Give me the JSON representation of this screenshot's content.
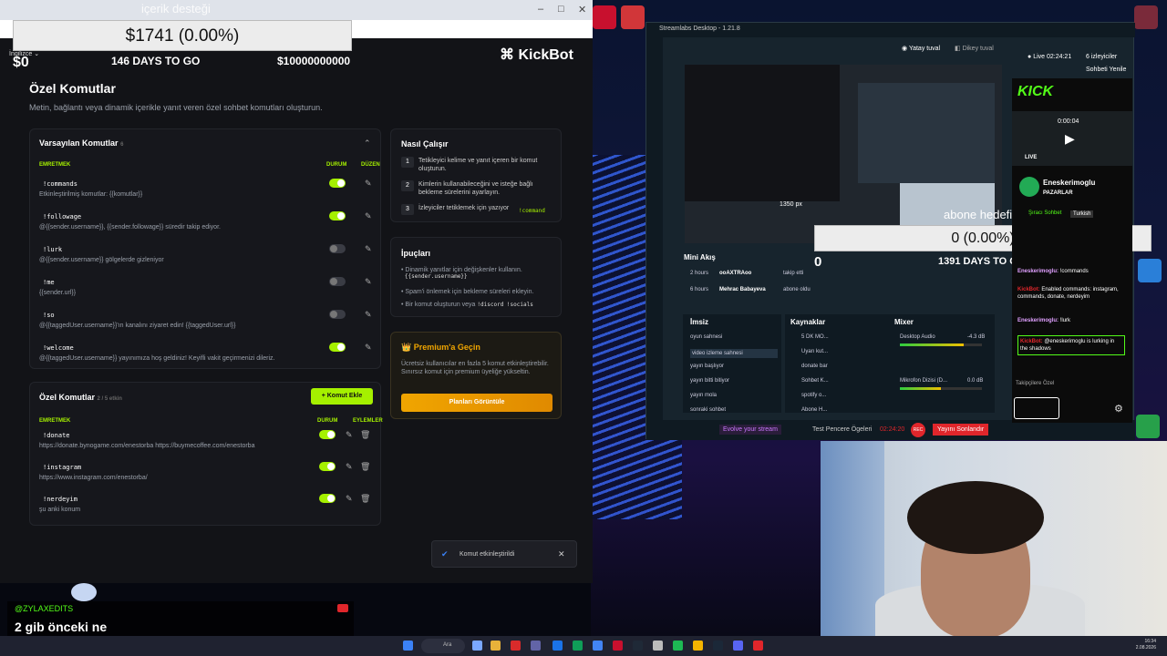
{
  "overlay": {
    "top_label": "içerik desteği",
    "donation_total": "$1741 (0.00%)",
    "left_value": "$0",
    "days_to_go": "146 DAYS TO GO",
    "goal": "$10000000000",
    "language": "İngilizce"
  },
  "kickbot": {
    "logo": "KickBot",
    "page_title": "Özel Komutlar",
    "page_subtitle": "Metin, bağlantı veya dinamik içerikle yanıt veren özel sohbet komutları oluşturun.",
    "default_section": {
      "title": "Varsayılan Komutlar",
      "count": "6",
      "col_command": "EMRETMEK",
      "col_status": "DURUM",
      "col_edit": "DÜZEN",
      "rows": [
        {
          "cmd": "!commands",
          "desc": "Etkinleştirilmiş komutlar: {{komutlar}}",
          "enabled": true
        },
        {
          "cmd": "!followage",
          "desc": "@{{sender.username}}, {{sender.followage}} süredir takip ediyor.",
          "enabled": true
        },
        {
          "cmd": "!lurk",
          "desc": "@{{sender.username}} gölgelerde gizleniyor",
          "enabled": false
        },
        {
          "cmd": "!me",
          "desc": "{{sender.url}}",
          "enabled": false
        },
        {
          "cmd": "!so",
          "desc": "@{{taggedUser.username}}'ın kanalını ziyaret edin! {{taggedUser.url}}",
          "enabled": false
        },
        {
          "cmd": "!welcome",
          "desc": "@{{taggedUser.username}} yayınımıza hoş geldiniz! Keyifli vakit geçirmenizi dileriz.",
          "enabled": true
        }
      ]
    },
    "custom_section": {
      "title": "Özel Komutlar",
      "count": "2 / 5 etkin",
      "add_button": "+ Komut Ekle",
      "col_command": "EMRETMEK",
      "col_status": "DURUM",
      "col_actions": "EYLEMLER",
      "rows": [
        {
          "cmd": "!donate",
          "desc": "https://donate.bynogame.com/enestorba https://buymecoffee.com/enestorba",
          "enabled": true
        },
        {
          "cmd": "!instagram",
          "desc": "https://www.instagram.com/enestorba/",
          "enabled": true
        },
        {
          "cmd": "!nerdeyim",
          "desc": "şu anki konum",
          "enabled": true
        }
      ]
    },
    "how_it_works": {
      "title": "Nasıl Çalışır",
      "steps": [
        {
          "num": "1",
          "text": "Tetikleyici kelime ve yanıt içeren bir komut oluşturun."
        },
        {
          "num": "2",
          "text": "Kimlerin kullanabileceğini ve isteğe bağlı bekleme sürelerini ayarlayın."
        },
        {
          "num": "3",
          "text": "İzleyiciler tetiklemek için yazıyor"
        }
      ],
      "step3_code": "!command"
    },
    "tips": {
      "title": "İpuçları",
      "items": [
        "Dinamik yanıtlar için değişkenler kullanın.",
        "Spam'i önlemek için bekleme süreleri ekleyin.",
        "Bir komut oluşturun veya"
      ],
      "code1": "{{sender.username}}",
      "code3": "!discord !socials"
    },
    "premium": {
      "title": "Premium'a Geçin",
      "text": "Ücretsiz kullanıcılar en fazla 5 komut etkinleştirebilir. Sınırsız komut için premium üyeliğe yükseltin.",
      "button": "Planları Görüntüle"
    },
    "toast": "Komut etkinleştirildi"
  },
  "streamlabs": {
    "title": "Streamlabs Desktop - 1.21.8",
    "horizontal": "Yatay tuval",
    "vertical": "Dikey tuval",
    "live": "Live 02:24:21",
    "viewers": "6 izleyiciler",
    "chat_reset": "Sohbeti Yenile",
    "mini_feed_title": "Mini Akış",
    "feed": [
      {
        "time": "2 hours",
        "user": "ooAXTRAoo",
        "action": "takip etti"
      },
      {
        "time": "6 hours",
        "user": "Mehrac Babayeva",
        "action": "abone oldu"
      }
    ],
    "scenes_title": "İmsiz",
    "scenes": [
      "oyun sahnesi",
      "video izleme sahnesi",
      "yayın başlıyor",
      "yayın bitti bitiyor",
      "yayın mola",
      "sonraki sohbet"
    ],
    "sources_title": "Kaynaklar",
    "sources": [
      "5 DK MO...",
      "Uyarı kut...",
      "donate bar",
      "Sohbet K...",
      "spotify o...",
      "Abone H..."
    ],
    "mixer_title": "Mixer",
    "mixer": [
      {
        "name": "Desktop Audio",
        "db": "-4.3 dB",
        "level": 0.78
      },
      {
        "name": "Mikrofon Dizisi (D...",
        "db": "0.0 dB",
        "level": 0.5
      }
    ],
    "footer_evolve": "Evolve your stream",
    "footer_test": "Test Pencere Ögeleri",
    "footer_time": "02:24:20",
    "footer_rec": "REC",
    "footer_end": "Yayını Sonlandır",
    "preview_px": "1350 px",
    "subgoal_label": "abone hedefi",
    "subgoal_value": "0 (0.00%)",
    "subgoal_left": "0",
    "subgoal_days": "1391 DAYS TO GO"
  },
  "kick_chat": {
    "time": "0:00:04",
    "live": "LIVE",
    "channel": "Eneskerimoglu",
    "category": "PAZARLAR",
    "tag1": "Şıracı Sohbet",
    "tag2": "Turkish",
    "messages": [
      {
        "user": "Eneskerimoglu:",
        "text": "!commands"
      },
      {
        "user": "KickBot:",
        "text": "Enabled commands: instagram, commands, donate, nerdeyim"
      },
      {
        "user": "Eneskerimoglu:",
        "text": "!lurk"
      },
      {
        "user": "KickBot:",
        "text": "@eneskerimoglu is lurking in the shadows"
      }
    ],
    "followers_only": "Takipçilere Özel"
  },
  "alert": {
    "handle": "@ZYLAXEDITS",
    "text": "2 gib önceki ne"
  },
  "taskbar": {
    "search": "Ara",
    "time": "16:34",
    "date": "2.08.2026"
  },
  "colors": {
    "accent": "#a5f000",
    "premium": "#f0a500",
    "live_red": "#e0262b",
    "sl_bg": "#17242d"
  }
}
